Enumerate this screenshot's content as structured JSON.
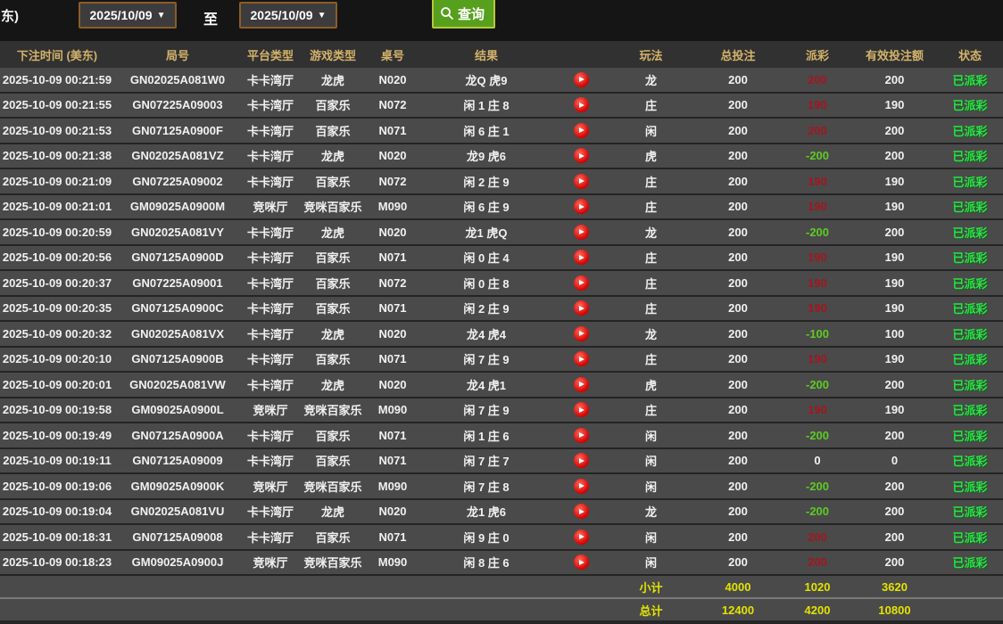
{
  "toolbar": {
    "partial_label": "东)",
    "date_from": "2025/10/09",
    "to_label": "至",
    "date_to": "2025/10/09",
    "dropdown_arrow": "▼",
    "query_label": "查询"
  },
  "colors": {
    "header_text": "#d3b26b",
    "payout_positive": "#a3161f",
    "payout_negative": "#5ecb22",
    "status_green": "#2ee04a",
    "footer_yellow": "#e3e300",
    "query_button_green": "#57a01d",
    "datepicker_border_brown": "#8d5c28",
    "row_bg": "#4a4a4a"
  },
  "table": {
    "columns": [
      "下注时间 (美东)",
      "局号",
      "平台类型",
      "游戏类型",
      "桌号",
      "结果",
      "",
      "玩法",
      "总投注",
      "派彩",
      "有效投注额",
      "状态"
    ],
    "rows": [
      {
        "time": "2025-10-09 00:21:59",
        "round": "GN02025A081W0",
        "platform": "卡卡湾厅",
        "game": "龙虎",
        "table": "N020",
        "result": "龙Q 虎9",
        "bet_type": "龙",
        "total_bet": "200",
        "payout": "200",
        "valid_bet": "200",
        "status": "已派彩"
      },
      {
        "time": "2025-10-09 00:21:55",
        "round": "GN07225A09003",
        "platform": "卡卡湾厅",
        "game": "百家乐",
        "table": "N072",
        "result": "闲 1 庄 8",
        "bet_type": "庄",
        "total_bet": "200",
        "payout": "190",
        "valid_bet": "190",
        "status": "已派彩"
      },
      {
        "time": "2025-10-09 00:21:53",
        "round": "GN07125A0900F",
        "platform": "卡卡湾厅",
        "game": "百家乐",
        "table": "N071",
        "result": "闲 6 庄 1",
        "bet_type": "闲",
        "total_bet": "200",
        "payout": "200",
        "valid_bet": "200",
        "status": "已派彩"
      },
      {
        "time": "2025-10-09 00:21:38",
        "round": "GN02025A081VZ",
        "platform": "卡卡湾厅",
        "game": "龙虎",
        "table": "N020",
        "result": "龙9 虎6",
        "bet_type": "虎",
        "total_bet": "200",
        "payout": "-200",
        "valid_bet": "200",
        "status": "已派彩"
      },
      {
        "time": "2025-10-09 00:21:09",
        "round": "GN07225A09002",
        "platform": "卡卡湾厅",
        "game": "百家乐",
        "table": "N072",
        "result": "闲 2 庄 9",
        "bet_type": "庄",
        "total_bet": "200",
        "payout": "190",
        "valid_bet": "190",
        "status": "已派彩"
      },
      {
        "time": "2025-10-09 00:21:01",
        "round": "GM09025A0900M",
        "platform": "竞咪厅",
        "game": "竞咪百家乐",
        "table": "M090",
        "result": "闲 6 庄 9",
        "bet_type": "庄",
        "total_bet": "200",
        "payout": "190",
        "valid_bet": "190",
        "status": "已派彩"
      },
      {
        "time": "2025-10-09 00:20:59",
        "round": "GN02025A081VY",
        "platform": "卡卡湾厅",
        "game": "龙虎",
        "table": "N020",
        "result": "龙1 虎Q",
        "bet_type": "龙",
        "total_bet": "200",
        "payout": "-200",
        "valid_bet": "200",
        "status": "已派彩"
      },
      {
        "time": "2025-10-09 00:20:56",
        "round": "GN07125A0900D",
        "platform": "卡卡湾厅",
        "game": "百家乐",
        "table": "N071",
        "result": "闲 0 庄 4",
        "bet_type": "庄",
        "total_bet": "200",
        "payout": "190",
        "valid_bet": "190",
        "status": "已派彩"
      },
      {
        "time": "2025-10-09 00:20:37",
        "round": "GN07225A09001",
        "platform": "卡卡湾厅",
        "game": "百家乐",
        "table": "N072",
        "result": "闲 0 庄 8",
        "bet_type": "庄",
        "total_bet": "200",
        "payout": "190",
        "valid_bet": "190",
        "status": "已派彩"
      },
      {
        "time": "2025-10-09 00:20:35",
        "round": "GN07125A0900C",
        "platform": "卡卡湾厅",
        "game": "百家乐",
        "table": "N071",
        "result": "闲 2 庄 9",
        "bet_type": "庄",
        "total_bet": "200",
        "payout": "190",
        "valid_bet": "190",
        "status": "已派彩"
      },
      {
        "time": "2025-10-09 00:20:32",
        "round": "GN02025A081VX",
        "platform": "卡卡湾厅",
        "game": "龙虎",
        "table": "N020",
        "result": "龙4 虎4",
        "bet_type": "龙",
        "total_bet": "200",
        "payout": "-100",
        "valid_bet": "100",
        "status": "已派彩"
      },
      {
        "time": "2025-10-09 00:20:10",
        "round": "GN07125A0900B",
        "platform": "卡卡湾厅",
        "game": "百家乐",
        "table": "N071",
        "result": "闲 7 庄 9",
        "bet_type": "庄",
        "total_bet": "200",
        "payout": "190",
        "valid_bet": "190",
        "status": "已派彩"
      },
      {
        "time": "2025-10-09 00:20:01",
        "round": "GN02025A081VW",
        "platform": "卡卡湾厅",
        "game": "龙虎",
        "table": "N020",
        "result": "龙4 虎1",
        "bet_type": "虎",
        "total_bet": "200",
        "payout": "-200",
        "valid_bet": "200",
        "status": "已派彩"
      },
      {
        "time": "2025-10-09 00:19:58",
        "round": "GM09025A0900L",
        "platform": "竞咪厅",
        "game": "竞咪百家乐",
        "table": "M090",
        "result": "闲 7 庄 9",
        "bet_type": "庄",
        "total_bet": "200",
        "payout": "190",
        "valid_bet": "190",
        "status": "已派彩"
      },
      {
        "time": "2025-10-09 00:19:49",
        "round": "GN07125A0900A",
        "platform": "卡卡湾厅",
        "game": "百家乐",
        "table": "N071",
        "result": "闲 1 庄 6",
        "bet_type": "闲",
        "total_bet": "200",
        "payout": "-200",
        "valid_bet": "200",
        "status": "已派彩"
      },
      {
        "time": "2025-10-09 00:19:11",
        "round": "GN07125A09009",
        "platform": "卡卡湾厅",
        "game": "百家乐",
        "table": "N071",
        "result": "闲 7 庄 7",
        "bet_type": "闲",
        "total_bet": "200",
        "payout": "0",
        "valid_bet": "0",
        "status": "已派彩"
      },
      {
        "time": "2025-10-09 00:19:06",
        "round": "GM09025A0900K",
        "platform": "竞咪厅",
        "game": "竞咪百家乐",
        "table": "M090",
        "result": "闲 7 庄 8",
        "bet_type": "闲",
        "total_bet": "200",
        "payout": "-200",
        "valid_bet": "200",
        "status": "已派彩"
      },
      {
        "time": "2025-10-09 00:19:04",
        "round": "GN02025A081VU",
        "platform": "卡卡湾厅",
        "game": "龙虎",
        "table": "N020",
        "result": "龙1 虎6",
        "bet_type": "龙",
        "total_bet": "200",
        "payout": "-200",
        "valid_bet": "200",
        "status": "已派彩"
      },
      {
        "time": "2025-10-09 00:18:31",
        "round": "GN07125A09008",
        "platform": "卡卡湾厅",
        "game": "百家乐",
        "table": "N071",
        "result": "闲 9 庄 0",
        "bet_type": "闲",
        "total_bet": "200",
        "payout": "200",
        "valid_bet": "200",
        "status": "已派彩"
      },
      {
        "time": "2025-10-09 00:18:23",
        "round": "GM09025A0900J",
        "platform": "竞咪厅",
        "game": "竞咪百家乐",
        "table": "M090",
        "result": "闲 8 庄 6",
        "bet_type": "闲",
        "total_bet": "200",
        "payout": "200",
        "valid_bet": "200",
        "status": "已派彩"
      }
    ],
    "footer": {
      "subtotal": {
        "label": "小计",
        "total_bet": "4000",
        "payout": "1020",
        "valid_bet": "3620"
      },
      "grand_total": {
        "label": "总计",
        "total_bet": "12400",
        "payout": "4200",
        "valid_bet": "10800"
      }
    }
  }
}
